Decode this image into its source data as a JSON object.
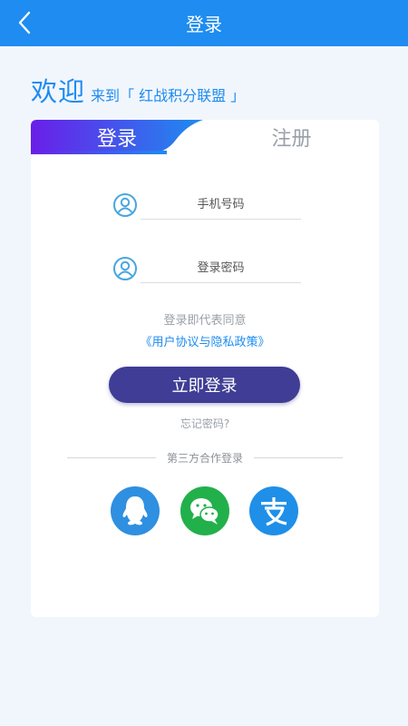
{
  "header": {
    "title": "登录"
  },
  "welcome": {
    "big": "欢迎",
    "small": "来到「 红战积分联盟 」"
  },
  "tabs": [
    {
      "label": "登录",
      "active": true
    },
    {
      "label": "注册",
      "active": false
    }
  ],
  "form": {
    "phone_placeholder": "手机号码",
    "phone_value": "",
    "password_placeholder": "登录密码",
    "password_value": ""
  },
  "agreement": {
    "text": "登录即代表同意",
    "link": "《用户协议与隐私政策》"
  },
  "login_button": "立即登录",
  "forgot_password": "忘记密码?",
  "third_party": {
    "label": "第三方合作登录",
    "providers": [
      {
        "name": "qq-icon",
        "color": "#2f8fe0"
      },
      {
        "name": "wechat-icon",
        "color": "#22b04b"
      },
      {
        "name": "alipay-icon",
        "color": "#1f8fe8"
      }
    ]
  },
  "colors": {
    "primary": "#1e8cf0",
    "button": "#3f3d95",
    "tab_gradient_start": "#6a1ee8",
    "tab_gradient_end": "#1e8cf0"
  }
}
